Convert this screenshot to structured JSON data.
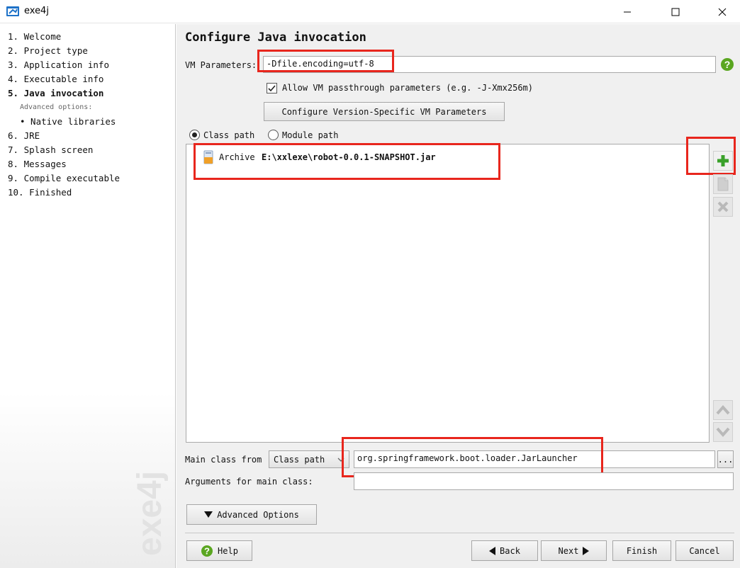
{
  "window": {
    "title": "exe4j"
  },
  "sidebar": {
    "items": [
      {
        "label": "1. Welcome"
      },
      {
        "label": "2. Project type"
      },
      {
        "label": "3. Application info"
      },
      {
        "label": "4. Executable info"
      },
      {
        "label": "5. Java invocation"
      },
      {
        "label": "6. JRE"
      },
      {
        "label": "7. Splash screen"
      },
      {
        "label": "8. Messages"
      },
      {
        "label": "9. Compile executable"
      },
      {
        "label": "10. Finished"
      }
    ],
    "advanced_title": "Advanced options:",
    "advanced_items": [
      {
        "label": "• Native libraries"
      }
    ],
    "watermark": "exe4j"
  },
  "page": {
    "title": "Configure Java invocation",
    "vm_params_label": "VM Parameters:",
    "vm_params_value": "-Dfile.encoding=utf-8",
    "passthrough_label": "Allow VM passthrough parameters (e.g. -J-Xmx256m)",
    "version_button": "Configure Version-Specific VM Parameters",
    "classpath_radio": "Class path",
    "modulepath_radio": "Module path",
    "archive_type": "Archive",
    "archive_path": "E:\\xxlexe\\robot-0.0.1-SNAPSHOT.jar",
    "main_class_label": "Main class from",
    "main_class_source": "Class path",
    "main_class_value": "org.springframework.boot.loader.JarLauncher",
    "browse_label": "...",
    "args_label": "Arguments for main class:",
    "args_value": "",
    "advanced_button": "Advanced Options"
  },
  "footer": {
    "help": "Help",
    "back": "Back",
    "next": "Next",
    "finish": "Finish",
    "cancel": "Cancel"
  },
  "colors": {
    "highlight_box": "#e8261d",
    "add_icon": "#3aa12a",
    "help_icon": "#5aa620"
  }
}
